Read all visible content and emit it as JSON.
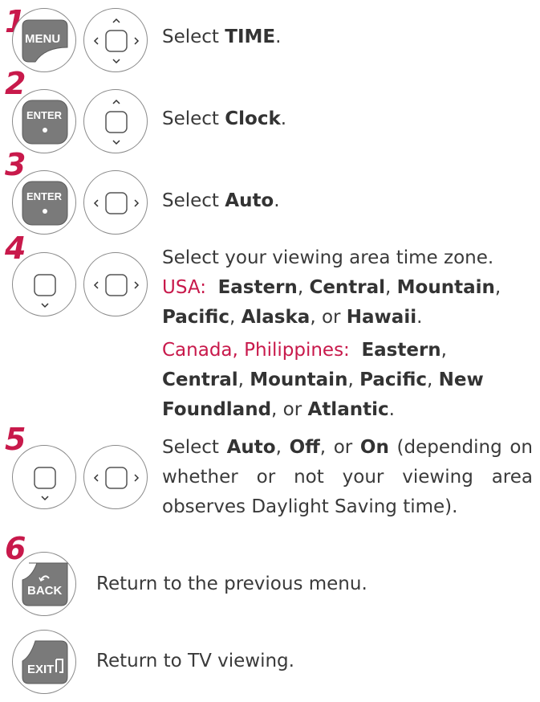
{
  "steps": [
    {
      "number": "1",
      "key": "MENU",
      "text_prefix": "Select ",
      "bold": "TIME",
      "text_suffix": "."
    },
    {
      "number": "2",
      "key": "ENTER",
      "text_prefix": "Select ",
      "bold": "Clock",
      "text_suffix": "."
    },
    {
      "number": "3",
      "key": "ENTER",
      "text_prefix": "Select ",
      "bold": "Auto",
      "text_suffix": "."
    },
    {
      "number": "4",
      "line1": "Select your viewing area time zone.",
      "usa_label": "USA:",
      "usa": [
        "Eastern",
        "Central",
        "Mountain",
        "Pacific",
        "Alaska",
        "Hawaii"
      ],
      "canada_label": "Canada, Philippines:",
      "canada": [
        "Eastern",
        "Central",
        "Mountain",
        "Pacific",
        "New Foundland",
        "Atlantic"
      ],
      "sep": ", ",
      "or": "or",
      "end": "."
    },
    {
      "number": "5",
      "select": "Select",
      "opt1": "Auto",
      "opt2": "Off",
      "opt3": "On",
      "rest": "(depending on whether or not your viewing area observes Daylight Saving time)."
    },
    {
      "number": "6",
      "key": "BACK",
      "text": "Return to the previous menu."
    },
    {
      "key": "EXIT",
      "text": "Return to TV viewing."
    }
  ],
  "colors": {
    "accent": "#c8194b",
    "key_fill": "#7a7a7a"
  },
  "icons": [
    "menu-key-icon",
    "enter-key-icon",
    "back-key-icon",
    "exit-key-icon",
    "dpad-icon"
  ]
}
